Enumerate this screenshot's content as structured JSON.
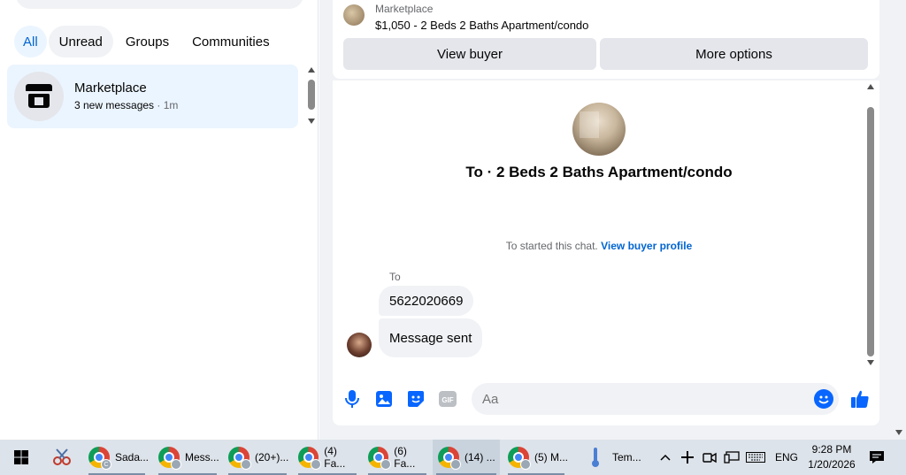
{
  "left": {
    "filters": [
      "All",
      "Unread",
      "Groups",
      "Communities"
    ],
    "conversation": {
      "title": "Marketplace",
      "subtitle": "3 new messages",
      "time": " · 1m"
    }
  },
  "top_card": {
    "label": "Marketplace",
    "listing": "$1,050 - 2 Beds 2 Baths Apartment/condo",
    "view_buyer": "View buyer",
    "more_options": "More options"
  },
  "chat": {
    "title": "To · 2 Beds 2 Baths Apartment/condo",
    "started_text": "To started this chat.",
    "started_link": "View buyer profile",
    "sender": "To",
    "messages": [
      "5622020669",
      "Message sent"
    ]
  },
  "composer": {
    "placeholder": "Aa"
  },
  "taskbar": {
    "apps": [
      "Sada...",
      "Mess...",
      "(20+)...",
      "(4) Fa...",
      "(6) Fa...",
      "(14) ...",
      "(5) M...",
      "Tem..."
    ],
    "language": "ENG",
    "time": "9:28 PM",
    "date": "1/20/2026"
  },
  "colors": {
    "accent": "#0866ff",
    "link": "#0064d1",
    "chip_active_bg": "#ebf5ff",
    "bubble": "#f0f2f5"
  }
}
